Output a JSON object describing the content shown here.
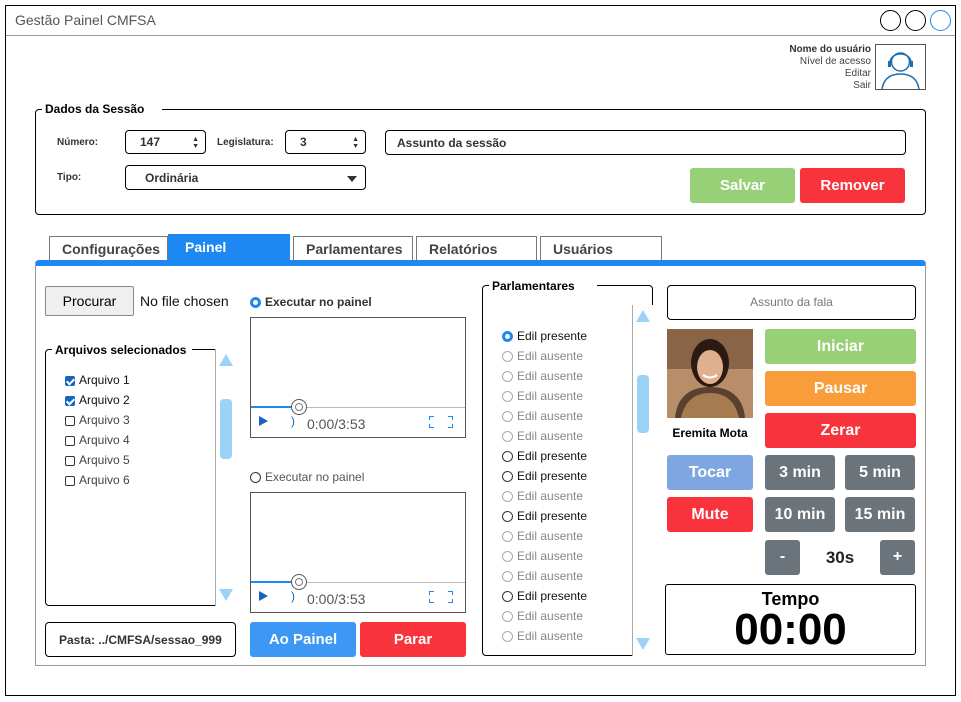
{
  "window": {
    "title": "Gestão Painel CMFSA"
  },
  "user": {
    "name": "Nome do usuário",
    "level": "Nível de acesso",
    "edit": "Editar",
    "logout": "Sair"
  },
  "session": {
    "legend": "Dados da Sessão",
    "numero_label": "Número:",
    "numero_value": "147",
    "legislatura_label": "Legislatura:",
    "legislatura_value": "3",
    "assunto_placeholder": "Assunto da sessão",
    "tipo_label": "Tipo:",
    "tipo_value": "Ordinária",
    "save_label": "Salvar",
    "remove_label": "Remover"
  },
  "tabs": [
    "Configurações",
    "Painel",
    "Parlamentares",
    "Relatórios",
    "Usuários"
  ],
  "files": {
    "browse_label": "Procurar",
    "no_file": "No file chosen",
    "legend": "Arquivos selecionados",
    "items": [
      {
        "label": "Arquivo 1",
        "checked": true
      },
      {
        "label": "Arquivo 2",
        "checked": true
      },
      {
        "label": "Arquivo 3",
        "checked": false
      },
      {
        "label": "Arquivo 4",
        "checked": false
      },
      {
        "label": "Arquivo 5",
        "checked": false
      },
      {
        "label": "Arquivo 6",
        "checked": false
      }
    ],
    "pasta_label": "Pasta:",
    "pasta_value": "../CMFSA/sessao_999"
  },
  "players": [
    {
      "radio_label": "Executar no painel",
      "selected": true,
      "time": "0:00/3:53"
    },
    {
      "radio_label": "Executar no painel",
      "selected": false,
      "time": "0:00/3:53"
    }
  ],
  "player_actions": {
    "to_panel": "Ao Painel",
    "stop": "Parar"
  },
  "parlamentares": {
    "legend": "Parlamentares",
    "items": [
      {
        "label": "Edil presente",
        "state": "selected"
      },
      {
        "label": "Edil ausente",
        "state": "absent"
      },
      {
        "label": "Edil ausente",
        "state": "absent"
      },
      {
        "label": "Edil ausente",
        "state": "absent"
      },
      {
        "label": "Edil ausente",
        "state": "absent"
      },
      {
        "label": "Edil ausente",
        "state": "absent"
      },
      {
        "label": "Edil presente",
        "state": "present"
      },
      {
        "label": "Edil presente",
        "state": "present"
      },
      {
        "label": "Edil ausente",
        "state": "absent"
      },
      {
        "label": "Edil presente",
        "state": "present"
      },
      {
        "label": "Edil ausente",
        "state": "absent"
      },
      {
        "label": "Edil ausente",
        "state": "absent"
      },
      {
        "label": "Edil ausente",
        "state": "absent"
      },
      {
        "label": "Edil presente",
        "state": "present"
      },
      {
        "label": "Edil ausente",
        "state": "absent"
      },
      {
        "label": "Edil ausente",
        "state": "absent"
      }
    ]
  },
  "speech": {
    "assunto_placeholder": "Assunto da fala",
    "speaker_name": "Eremita Mota",
    "start": "Iniciar",
    "pause": "Pausar",
    "reset": "Zerar",
    "play": "Tocar",
    "mute": "Mute",
    "t3": "3 min",
    "t5": "5 min",
    "t10": "10 min",
    "t15": "15 min",
    "minus": "-",
    "step": "30s",
    "plus": "+",
    "tempo_label": "Tempo",
    "tempo_value": "00:00"
  },
  "colors": {
    "accent": "#1e88f2",
    "green": "#97d077",
    "red": "#f8333c",
    "orange": "#f99d3a",
    "gray": "#6b747b",
    "lightblue": "#7ea6e0"
  }
}
